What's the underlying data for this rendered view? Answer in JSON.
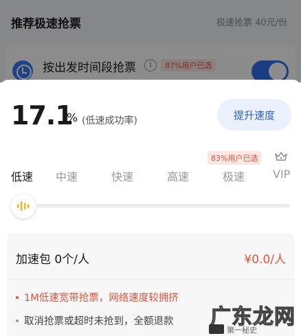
{
  "background": {
    "title": "推荐极速抢票",
    "price_note": "极速抢票 40元/份",
    "row_label": "按出发时间段抢票",
    "row_info": "i",
    "row_badge": "87%用户已选"
  },
  "rate": {
    "value": "17.1",
    "unit": "%",
    "caption": "(低速成功率)"
  },
  "boost_button": "提升速度",
  "tier_badge": "83%用户已选",
  "tabs": [
    "低速",
    "中速",
    "快速",
    "高速",
    "极速",
    "VIP"
  ],
  "selected_tab": "低速",
  "slider_level": 0,
  "pack": {
    "title": "加速包 0个/人",
    "price": "¥0.0/人",
    "bullets": [
      "1M低速宽带抢票，网络速度较拥挤",
      "取消抢票或超时未抢到，全额退款"
    ]
  },
  "watermark": {
    "main": "广东龙网",
    "sub": "第一秘史"
  },
  "colors": {
    "accent_blue": "#2c62d6",
    "accent_red": "#e5533d",
    "toggle_blue": "#2f6fe9"
  }
}
